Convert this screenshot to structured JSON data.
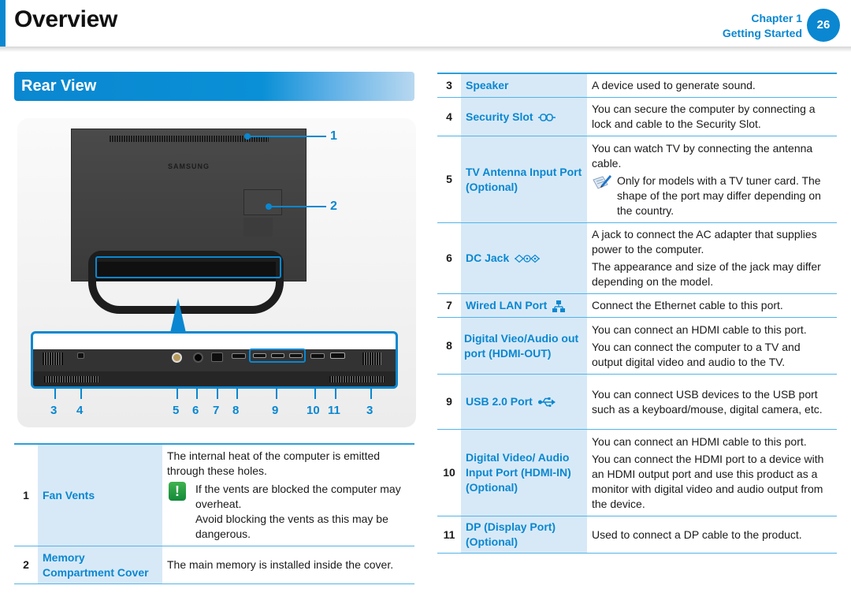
{
  "header": {
    "title": "Overview",
    "chapter": "Chapter 1",
    "chapter_subtitle": "Getting Started",
    "page_number": "26"
  },
  "section": {
    "title": "Rear View"
  },
  "illustration": {
    "brand_text": "SAMSUNG",
    "callouts_top": [
      "1",
      "2"
    ],
    "port_labels": [
      "3",
      "4",
      "5",
      "6",
      "7",
      "8",
      "9",
      "10",
      "11",
      "3"
    ]
  },
  "left_table": [
    {
      "num": "1",
      "name": "Fan Vents",
      "desc": [
        "The internal heat of the computer is emitted through these holes."
      ],
      "warning": [
        "If the vents are blocked the computer may overheat.",
        "Avoid blocking the vents as this may be dangerous."
      ],
      "icon": "warning-icon"
    },
    {
      "num": "2",
      "name": "Memory Compartment Cover",
      "desc": [
        "The main memory is installed inside the cover."
      ]
    }
  ],
  "right_table": [
    {
      "num": "3",
      "name": "Speaker",
      "desc": [
        "A device used to generate sound."
      ]
    },
    {
      "num": "4",
      "name": "Security Slot",
      "name_icon": "security-lock-icon",
      "desc": [
        "You can secure the computer by connecting a lock and cable to the Security Slot."
      ]
    },
    {
      "num": "5",
      "name": "TV Antenna Input Port (Optional)",
      "desc": [
        "You can watch TV by connecting the antenna cable."
      ],
      "note": "Only for models with a TV tuner card. The shape of the port may differ depending on the country.",
      "note_icon": "note-pencil-icon"
    },
    {
      "num": "6",
      "name": "DC Jack",
      "name_icon": "dc-jack-icon",
      "desc": [
        "A jack to connect the AC adapter that supplies power to the computer.",
        "The appearance and size of the jack may differ depending on the model."
      ]
    },
    {
      "num": "7",
      "name": "Wired LAN Port",
      "name_icon": "network-icon",
      "desc": [
        "Connect the Ethernet cable to this port."
      ]
    },
    {
      "num": "8",
      "name": "Digital Vieo/Audio out port (HDMI-OUT)",
      "desc": [
        "You can connect an HDMI cable to this port.",
        "You can connect the computer to a TV and output digital video and audio to the TV."
      ]
    },
    {
      "num": "9",
      "name": "USB 2.0 Port",
      "name_icon": "usb-icon",
      "desc": [
        "You can connect USB devices to the USB port such as a keyboard/mouse, digital camera, etc."
      ]
    },
    {
      "num": "10",
      "name": "Digital Video/ Audio Input Port (HDMI-IN) (Optional)",
      "desc": [
        "You can connect an HDMI cable to this port.",
        "You can connect the HDMI port to a device with an HDMI output port and use this product as a monitor with digital video and audio output from the device."
      ]
    },
    {
      "num": "11",
      "name": "DP (Display Port) (Optional)",
      "desc": [
        "Used to connect a DP cable to the product."
      ]
    }
  ],
  "colors": {
    "accent": "#0a87d0",
    "name_cell_bg": "#d7e9f7",
    "warning_green": "#1f9a3f"
  }
}
